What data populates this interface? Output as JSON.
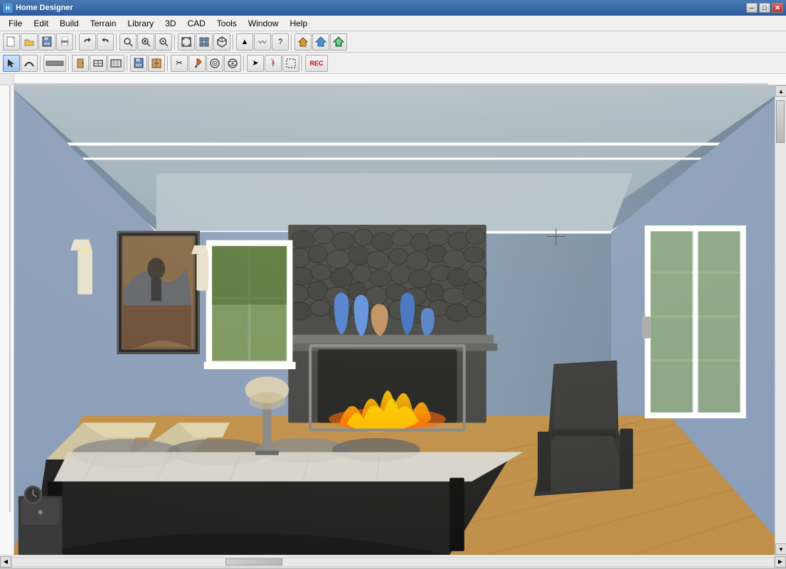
{
  "titleBar": {
    "title": "Home Designer",
    "minimizeLabel": "─",
    "maximizeLabel": "□",
    "closeLabel": "✕"
  },
  "menuBar": {
    "items": [
      "File",
      "Edit",
      "Build",
      "Terrain",
      "Library",
      "3D",
      "CAD",
      "Tools",
      "Window",
      "Help"
    ]
  },
  "toolbar1": {
    "buttons": [
      {
        "name": "new",
        "icon": "📄"
      },
      {
        "name": "open",
        "icon": "📂"
      },
      {
        "name": "save",
        "icon": "💾"
      },
      {
        "name": "print",
        "icon": "🖨"
      },
      {
        "name": "undo",
        "icon": "↩"
      },
      {
        "name": "redo",
        "icon": "↪"
      },
      {
        "name": "zoom-out-small",
        "icon": "🔍"
      },
      {
        "name": "zoom-in",
        "icon": "⊕"
      },
      {
        "name": "zoom-out",
        "icon": "⊖"
      },
      {
        "name": "fit",
        "icon": "⤢"
      },
      {
        "name": "select-box",
        "icon": "▣"
      },
      {
        "name": "pan",
        "icon": "✋"
      },
      {
        "name": "layer",
        "icon": "≡"
      },
      {
        "name": "arrow-up",
        "icon": "↑"
      },
      {
        "name": "wave",
        "icon": "〰"
      },
      {
        "name": "help",
        "icon": "?"
      },
      {
        "name": "house1",
        "icon": "⌂"
      },
      {
        "name": "house2",
        "icon": "🏠"
      },
      {
        "name": "house3",
        "icon": "🏡"
      }
    ]
  },
  "toolbar2": {
    "buttons": [
      {
        "name": "pointer",
        "icon": "↖"
      },
      {
        "name": "curve",
        "icon": "∿"
      },
      {
        "name": "wall",
        "icon": "▬"
      },
      {
        "name": "door",
        "icon": "🚪"
      },
      {
        "name": "window-tool",
        "icon": "⬜"
      },
      {
        "name": "stairs",
        "icon": "▤"
      },
      {
        "name": "save2",
        "icon": "💾"
      },
      {
        "name": "cabinet",
        "icon": "▦"
      },
      {
        "name": "delete",
        "icon": "✂"
      },
      {
        "name": "paint",
        "icon": "🎨"
      },
      {
        "name": "texture",
        "icon": "◈"
      },
      {
        "name": "material",
        "icon": "◉"
      },
      {
        "name": "arrow",
        "icon": "➤"
      },
      {
        "name": "north",
        "icon": "N"
      },
      {
        "name": "select2",
        "icon": "⬚"
      },
      {
        "name": "rec",
        "icon": "REC"
      }
    ]
  },
  "canvas": {
    "backgroundColor": "#8a9db5",
    "description": "3D bedroom view with fireplace"
  },
  "statusBar": {
    "text": ""
  }
}
